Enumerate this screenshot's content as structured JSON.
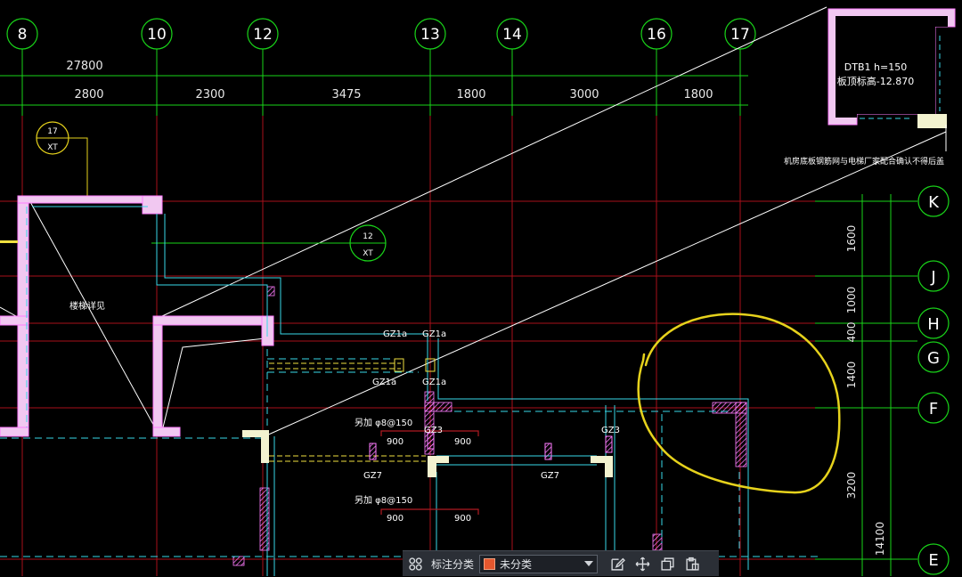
{
  "colors": {
    "background": "#000000",
    "axis_green": "#19d419",
    "grid_red": "#b0101a",
    "wall_magenta": "#ff7cff",
    "cyan": "#38d8e8",
    "yellow": "#f0e040",
    "annotation_yellow": "#e6d21c",
    "white": "#ffffff"
  },
  "column_axes": [
    {
      "label": "8"
    },
    {
      "label": "10"
    },
    {
      "label": "12"
    },
    {
      "label": "13"
    },
    {
      "label": "14"
    },
    {
      "label": "16"
    },
    {
      "label": "17"
    }
  ],
  "row_axes": [
    {
      "label": "K"
    },
    {
      "label": "J"
    },
    {
      "label": "H"
    },
    {
      "label": "G"
    },
    {
      "label": "F"
    },
    {
      "label": "E"
    }
  ],
  "top_dimensions": {
    "total": "27800",
    "segments": [
      "2800",
      "2300",
      "3475",
      "1800",
      "3000",
      "1800"
    ]
  },
  "right_dimensions": {
    "segments": [
      "1600",
      "1000",
      "400",
      "1400",
      "3200"
    ],
    "total": "14100"
  },
  "detail_callouts": [
    {
      "number": "17",
      "sheet": "XT"
    },
    {
      "number": "12",
      "sheet": "XT"
    }
  ],
  "detail_box": {
    "line1": "DTB1 h=150",
    "line2": "板顶标高-12.870",
    "note": "机房底板钢筋网与电梯厂家配合确认不得后盖"
  },
  "plan_labels": {
    "stair": "楼梯详见",
    "gz1a_1": "GZ1a",
    "gz1a_2": "GZ1a",
    "gz1a_3": "GZ1a",
    "gz1a_4": "GZ1a",
    "gz3_1": "GZ3",
    "gz3_2": "GZ3",
    "gz7_1": "GZ7",
    "gz7_2": "GZ7",
    "rebar_1": "另加 φ8@150",
    "rebar_2": "另加 φ8@150",
    "dim_900_a": "900",
    "dim_900_b": "900",
    "dim_900_c": "900",
    "dim_900_d": "900"
  },
  "toolbar": {
    "grid_icon": "grid-icon",
    "label": "标注分类",
    "selected": "未分类",
    "swatch_color": "#e4572e",
    "tools": [
      "edit-icon",
      "move-icon",
      "copy-icon",
      "paste-icon"
    ]
  }
}
